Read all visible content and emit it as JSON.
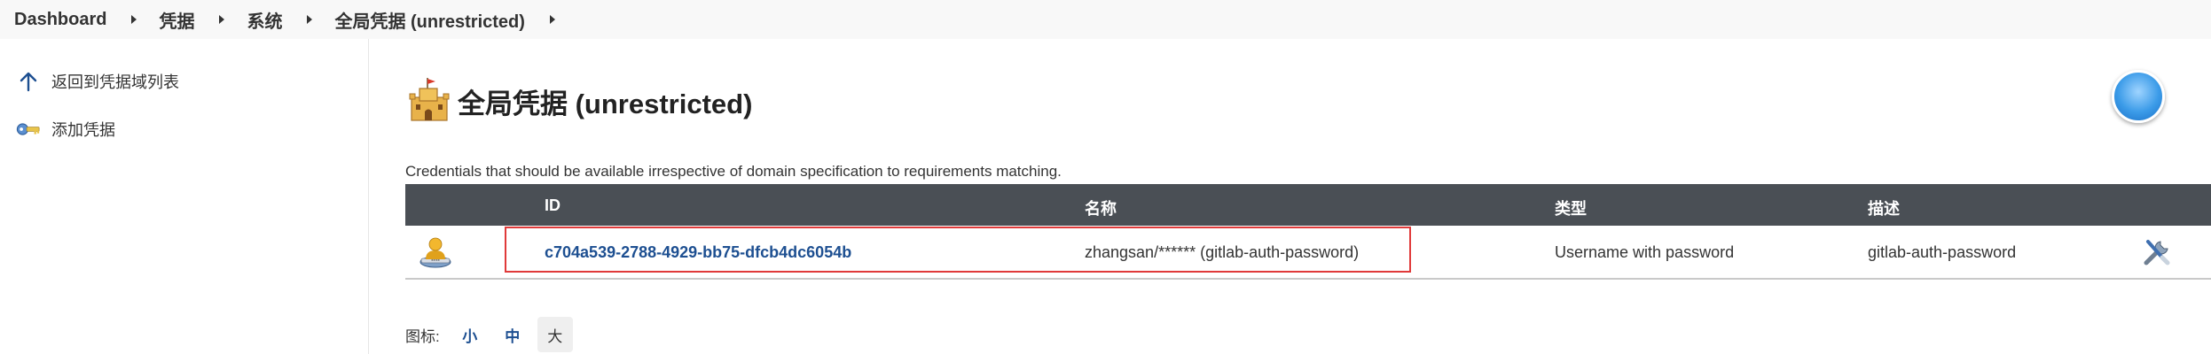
{
  "breadcrumb": [
    {
      "label": "Dashboard"
    },
    {
      "label": "凭据"
    },
    {
      "label": "系统"
    },
    {
      "label": "全局凭据 (unrestricted)"
    }
  ],
  "sidebar": {
    "items": [
      {
        "label": "返回到凭据域列表",
        "icon": "arrow-up-icon"
      },
      {
        "label": "添加凭据",
        "icon": "key-icon"
      }
    ]
  },
  "main": {
    "title": "全局凭据 (unrestricted)",
    "title_icon": "castle-icon",
    "description": "Credentials that should be available irrespective of domain specification to requirements matching.",
    "table": {
      "headers": [
        "ID",
        "名称",
        "类型",
        "描述"
      ],
      "rows": [
        {
          "icon": "user-credential-icon",
          "id": "c704a539-2788-4929-bb75-dfcb4dc6054b",
          "name": "zhangsan/****** (gitlab-auth-password)",
          "type": "Username with password",
          "description": "gitlab-auth-password",
          "action_icon": "configure-wrench-icon"
        }
      ]
    },
    "icon_size": {
      "label": "图标:",
      "options": [
        {
          "label": "小",
          "selected": false
        },
        {
          "label": "中",
          "selected": false
        },
        {
          "label": "大",
          "selected": true
        }
      ]
    }
  },
  "colors": {
    "header_bg": "#4a4f55",
    "link": "#1d4f91",
    "highlight": "#e03a3a"
  }
}
